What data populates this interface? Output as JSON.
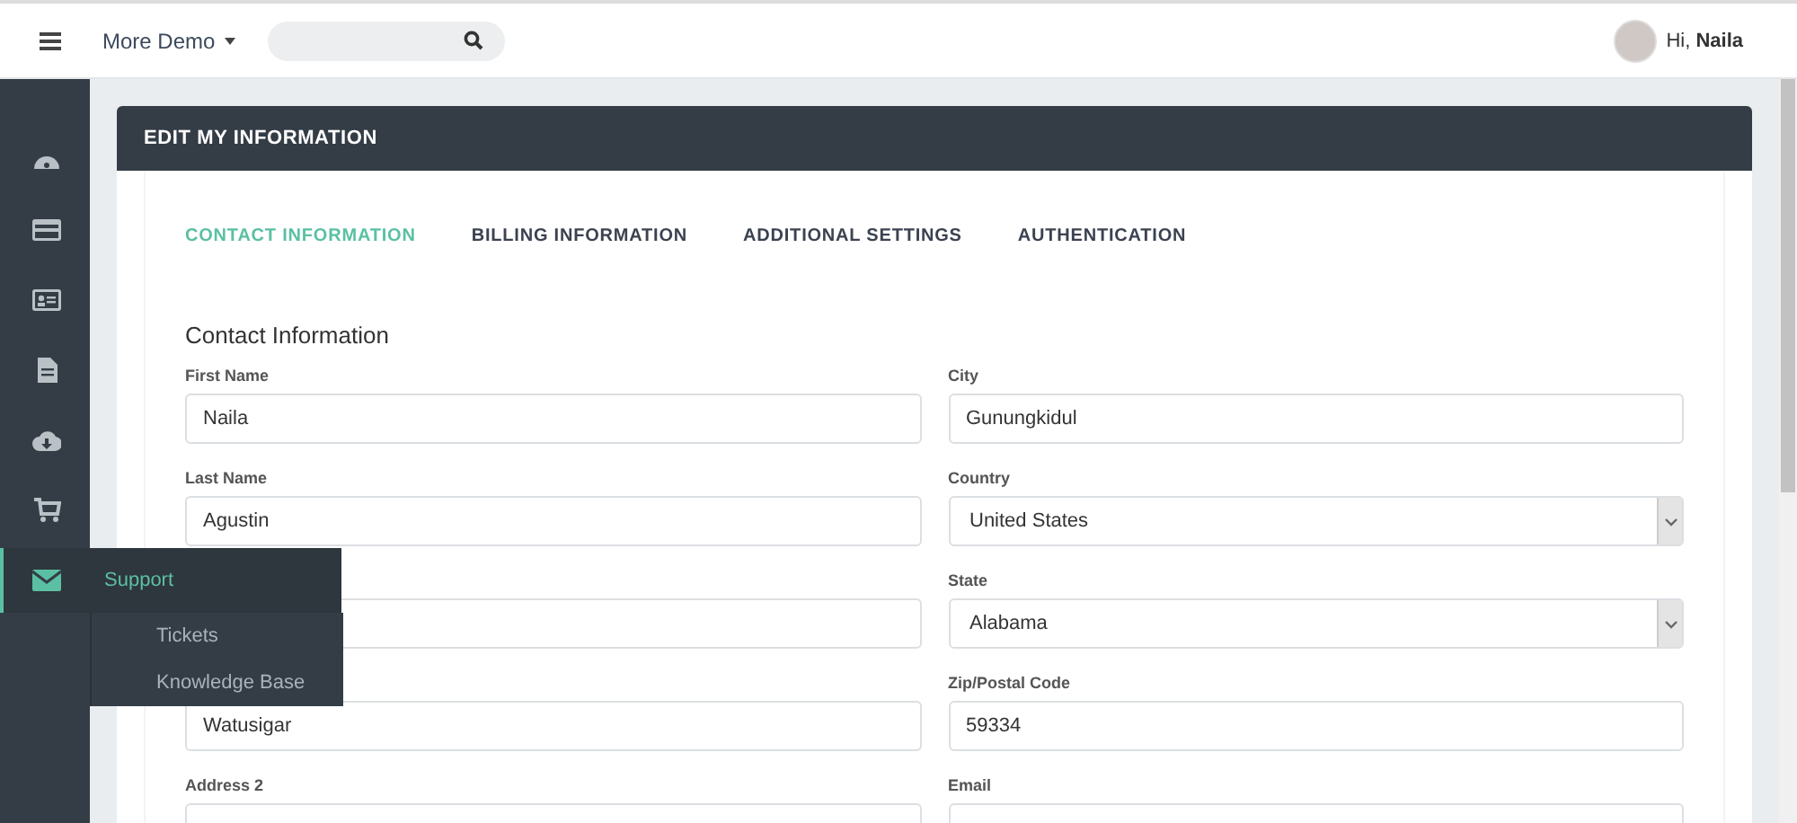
{
  "topbar": {
    "menu_label": "More Demo",
    "greeting": "Hi, ",
    "user_name": "Naila"
  },
  "sidebar": {
    "items": [
      {
        "selected": false
      },
      {
        "selected": false
      },
      {
        "selected": false
      },
      {
        "selected": false
      },
      {
        "selected": false
      },
      {
        "selected": false
      },
      {
        "selected": true,
        "label": "Support",
        "expanded": true,
        "children": [
          {
            "label": "Tickets"
          },
          {
            "label": "Knowledge Base"
          }
        ]
      }
    ]
  },
  "panel": {
    "title": "EDIT MY INFORMATION",
    "tabs": [
      {
        "label": "CONTACT INFORMATION",
        "selected": true
      },
      {
        "label": "BILLING INFORMATION",
        "selected": false
      },
      {
        "label": "ADDITIONAL SETTINGS",
        "selected": false
      },
      {
        "label": "AUTHENTICATION",
        "selected": false
      }
    ],
    "section_title": "Contact Information",
    "fields": [
      [
        {
          "label": "First Name",
          "value": "Naila",
          "kind": "text"
        },
        {
          "label": "City",
          "value": "Gunungkidul",
          "kind": "text"
        }
      ],
      [
        {
          "label": "Last Name",
          "value": "Agustin",
          "kind": "text"
        },
        {
          "label": "Country",
          "value": "United States",
          "kind": "select"
        }
      ],
      [
        {
          "kind": "text"
        },
        {
          "label": "State",
          "value": "Alabama",
          "kind": "select"
        }
      ],
      [
        {
          "value": "Watusigar",
          "kind": "text"
        },
        {
          "label": "Zip/Postal Code",
          "value": "59334",
          "kind": "text"
        }
      ],
      [
        {
          "label": "Address 2",
          "kind": "text"
        },
        {
          "label": "Email",
          "kind": "text"
        }
      ]
    ]
  }
}
